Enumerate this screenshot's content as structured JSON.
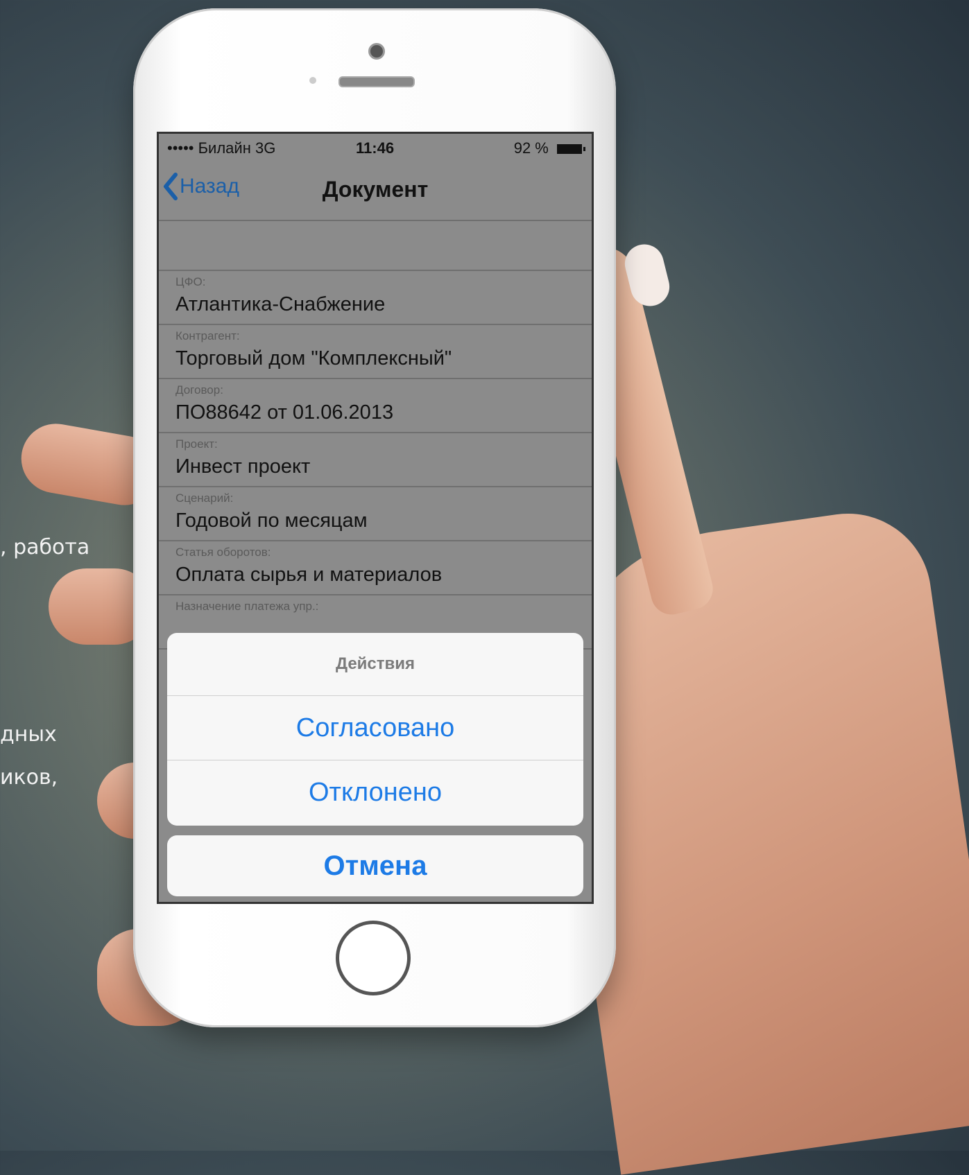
{
  "background_text": [
    ", работа",
    "дных",
    "иков,"
  ],
  "status_bar": {
    "carrier": "••••• Билайн  3G",
    "time": "11:46",
    "battery": "92 %"
  },
  "nav": {
    "back_label": "Назад",
    "title": "Документ"
  },
  "fields": [
    {
      "label": "ЦФО:",
      "value": "Атлантика-Снабжение"
    },
    {
      "label": "Контрагент:",
      "value": "Торговый дом \"Комплексный\""
    },
    {
      "label": "Договор:",
      "value": "ПО88642 от 01.06.2013"
    },
    {
      "label": "Проект:",
      "value": "Инвест проект"
    },
    {
      "label": "Сценарий:",
      "value": "Годовой по месяцам"
    },
    {
      "label": "Статья оборотов:",
      "value": "Оплата сырья и материалов"
    },
    {
      "label": "Назначение платежа упр.:",
      "value": ""
    }
  ],
  "action_sheet": {
    "title": "Действия",
    "options": [
      "Согласовано",
      "Отклонено"
    ],
    "cancel": "Отмена"
  },
  "colors": {
    "accent": "#1d7be6",
    "screen_dim": "#8b8b8b",
    "sheet_bg": "#f7f7f7"
  }
}
